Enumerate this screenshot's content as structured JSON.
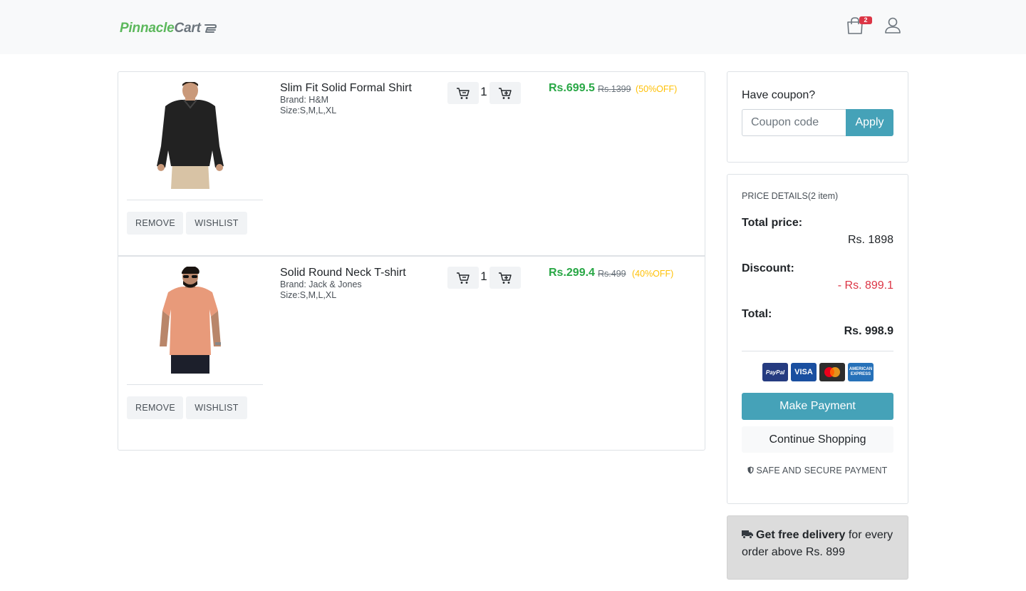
{
  "header": {
    "logo_primary": "Pinnacle",
    "logo_secondary": "Cart",
    "cart_count": "2"
  },
  "cart": {
    "items": [
      {
        "name": "Slim Fit Solid Formal Shirt",
        "brand": "Brand: H&M",
        "size": "Size:S,M,L,XL",
        "quantity": "1",
        "price": "Rs.699.5",
        "original_price": "Rs.1399",
        "discount": "(50%OFF)",
        "remove_label": "REMOVE",
        "wishlist_label": "WISHLIST"
      },
      {
        "name": "Solid Round Neck T-shirt",
        "brand": "Brand: Jack & Jones",
        "size": "Size:S,M,L,XL",
        "quantity": "1",
        "price": "Rs.299.4",
        "original_price": "Rs.499",
        "discount": "(40%OFF)",
        "remove_label": "REMOVE",
        "wishlist_label": "WISHLIST"
      }
    ]
  },
  "coupon": {
    "title": "Have coupon?",
    "placeholder": "Coupon code",
    "apply_label": "Apply"
  },
  "price_details": {
    "title": "PRICE DETAILS(2 item)",
    "total_price_label": "Total price:",
    "total_price_value": "Rs. 1898",
    "discount_label": "Discount:",
    "discount_value": "- Rs. 899.1",
    "total_label": "Total:",
    "total_value": "Rs. 998.9",
    "payment_methods": [
      "PayPal",
      "VISA",
      "Mastercard",
      "AMERICAN EXPRESS"
    ],
    "make_payment_label": "Make Payment",
    "continue_shopping_label": "Continue Shopping",
    "secure_label": "SAFE AND SECURE PAYMENT"
  },
  "delivery": {
    "bold_text": "Get free delivery",
    "rest_text": " for every order above Rs. 899"
  },
  "colors": {
    "accent": "#45a2b8",
    "price_green": "#28a745",
    "discount_red": "#dc3545",
    "off_yellow": "#ffc107"
  }
}
